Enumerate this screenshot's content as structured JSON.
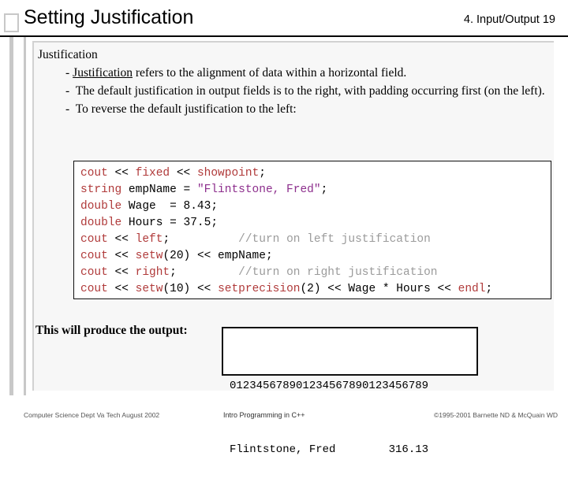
{
  "header": {
    "title": "Setting Justification",
    "chapter": "4. Input/Output  19"
  },
  "bullets": {
    "heading": "Justification",
    "items": [
      {
        "dash": "-",
        "lead": "Justification",
        "rest": " refers to the alignment of data within a horizontal field."
      },
      {
        "dash": "-",
        "lead": "",
        "rest": " The default justification in output fields is to the right, with padding occurring first (on the left)."
      },
      {
        "dash": "-",
        "lead": "",
        "rest": " To reverse the default justification to the left:"
      }
    ]
  },
  "code": {
    "lines": [
      [
        {
          "t": "cout",
          "c": "kw"
        },
        {
          "t": " << ",
          "c": "pl"
        },
        {
          "t": "fixed",
          "c": "kw"
        },
        {
          "t": " << ",
          "c": "pl"
        },
        {
          "t": "showpoint",
          "c": "kw"
        },
        {
          "t": ";",
          "c": "pl"
        }
      ],
      [
        {
          "t": "string",
          "c": "kw"
        },
        {
          "t": " empName = ",
          "c": "pl"
        },
        {
          "t": "\"Flintstone, Fred\"",
          "c": "str"
        },
        {
          "t": ";",
          "c": "pl"
        }
      ],
      [
        {
          "t": "double",
          "c": "kw"
        },
        {
          "t": " Wage  = 8.43;",
          "c": "pl"
        }
      ],
      [
        {
          "t": "double",
          "c": "kw"
        },
        {
          "t": " Hours = 37.5;",
          "c": "pl"
        }
      ],
      [
        {
          "t": "cout",
          "c": "kw"
        },
        {
          "t": " << ",
          "c": "pl"
        },
        {
          "t": "left",
          "c": "kw"
        },
        {
          "t": ";",
          "c": "pl"
        },
        {
          "t": "          ",
          "c": "pl"
        },
        {
          "t": "//turn on left justification",
          "c": "cmt"
        }
      ],
      [
        {
          "t": "cout",
          "c": "kw"
        },
        {
          "t": " << ",
          "c": "pl"
        },
        {
          "t": "setw",
          "c": "kw"
        },
        {
          "t": "(20) << empName;",
          "c": "pl"
        }
      ],
      [
        {
          "t": "cout",
          "c": "kw"
        },
        {
          "t": " << ",
          "c": "pl"
        },
        {
          "t": "right",
          "c": "kw"
        },
        {
          "t": ";",
          "c": "pl"
        },
        {
          "t": "         ",
          "c": "pl"
        },
        {
          "t": "//turn on right justification",
          "c": "cmt"
        }
      ],
      [
        {
          "t": "cout",
          "c": "kw"
        },
        {
          "t": " << ",
          "c": "pl"
        },
        {
          "t": "setw",
          "c": "kw"
        },
        {
          "t": "(10) << ",
          "c": "pl"
        },
        {
          "t": "setprecision",
          "c": "kw"
        },
        {
          "t": "(2) << Wage * Hours << ",
          "c": "pl"
        },
        {
          "t": "endl",
          "c": "kw"
        },
        {
          "t": ";",
          "c": "pl"
        }
      ]
    ]
  },
  "produce_label": "This will produce the output:",
  "output": {
    "ruler": "012345678901234567890123456789",
    "line": "Flintstone, Fred        316.13"
  },
  "footer": {
    "left": "Computer Science Dept Va Tech  August 2002",
    "center": "Intro Programming in C++",
    "right": "©1995-2001  Barnette ND & McQuain WD"
  },
  "colors": {
    "keyword": "#b03a3a",
    "string": "#8d2f8d",
    "comment": "#9b9b9b",
    "panel_bg": "#f7f7f7",
    "deco": "#c8c8c8"
  }
}
